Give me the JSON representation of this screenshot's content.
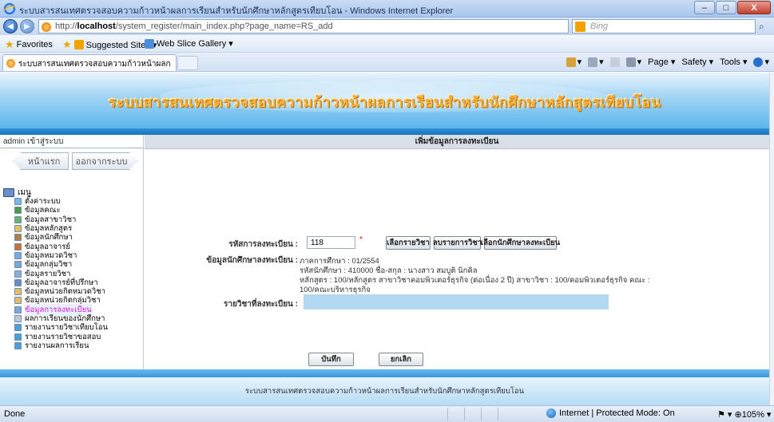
{
  "window": {
    "title": "ระบบสารสนเทศตรวจสอบความก้าวหน้าผลการเรียนสำหรับนักศึกษาหลักสูตรเทียบโอน - Windows Internet Explorer",
    "min": "–",
    "max": "□",
    "close": "X"
  },
  "address": {
    "url_prefix": "http://",
    "url_host": "localhost",
    "url_path": "/system_register/main_index.php?page_name=RS_add",
    "search_placeholder": "Bing"
  },
  "favorites": {
    "favorites_label": "Favorites",
    "suggested_label": "Suggested Sites ▾",
    "webslice_label": "Web Slice Gallery ▾"
  },
  "tab": {
    "label": "ระบบสารสนเทศตรวจสอบความก้าวหน้าผลการเรียนสำห..."
  },
  "command_bar": {
    "page": "Page ▾",
    "safety": "Safety ▾",
    "tools": "Tools ▾",
    "help": "▾"
  },
  "banner": {
    "title": "ระบบสารสนเทศตรวจสอบความก้าวหน้าผลการเรียนสำหรับนักศึกษาหลักสูตรเทียบโอน"
  },
  "sidebar": {
    "admin_line": "admin เข้าสู่ระบบ",
    "home_button": "หน้าแรก",
    "logout_button": "ออกจากระบบ",
    "menu_root": "เมนู",
    "items": [
      {
        "label": "ตั้งค่าระบบ",
        "color": "#7ab8e0"
      },
      {
        "label": "ข้อมูลคณะ",
        "color": "#4a9a4a"
      },
      {
        "label": "ข้อมูลสาขาวิชา",
        "color": "#6bb36b"
      },
      {
        "label": "ข้อมูลหลักสูตร",
        "color": "#e0c060"
      },
      {
        "label": "ข้อมูลนักศึกษา",
        "color": "#b08040"
      },
      {
        "label": "ข้อมูลอาจารย์",
        "color": "#d07030"
      },
      {
        "label": "ข้อมูลหมวดวิชา",
        "color": "#7aa8d8"
      },
      {
        "label": "ข้อมูลกลุ่มวิชา",
        "color": "#7aa8d8"
      },
      {
        "label": "ข้อมูลรายวิชา",
        "color": "#8ab0d8"
      },
      {
        "label": "ข้อมูลอาจารย์ที่ปรึกษา",
        "color": "#6a8ac0"
      },
      {
        "label": "ข้อมูลหน่วยกิตหมวดวิชา",
        "color": "#e0c060"
      },
      {
        "label": "ข้อมูลหน่วยกิตกลุ่มวิชา",
        "color": "#e0c060"
      },
      {
        "label": "ข้อมูลการลงทะเบียน",
        "color": "#7aa8d8"
      },
      {
        "label": "ผลการเรียนของนักศึกษา",
        "color": "#c0c8d8"
      },
      {
        "label": "รายงานรายวิชาเทียบโอน",
        "color": "#4aa0d8"
      },
      {
        "label": "รายงานรายวิชาขอสอบ",
        "color": "#4aa0d8"
      },
      {
        "label": "รายงานผลการเรียน",
        "color": "#4aa0d8"
      }
    ],
    "active_index": 12
  },
  "form": {
    "header": "เพิ่มข้อมูลการลงทะเบียน",
    "code_label": "รหัสการลงทะเบียน :",
    "code_value": "118",
    "required_mark": "*",
    "btn_select_subject": "เลือกรายวิชา",
    "btn_delete_subject": "ลบรายการวิชา",
    "btn_select_student": "เลือกนักศึกษาลงทะเบียน",
    "student_info_label": "ข้อมูลนักศึกษาลงทะเบียน :",
    "info_semester": "ภาคการศึกษา : 01/2554",
    "info_student": "รหัสนักศึกษา : 410000 ชื่อ-สกุล : นางสาว สมบูติ นิกคิล",
    "info_course": "หลักสูตร : 100/หลักสูตร สาขาวิชาคอมพิวเตอร์ธุรกิจ (ต่อเนื่อง 2 ปี) สาขาวิชา : 100/คอมพิวเตอร์ธุรกิจ คณะ :",
    "info_faculty": "100/คณะบริหารธุรกิจ",
    "subjects_label": "รายวิชาที่ลงทะเบียน :",
    "save_button": "บันทึก",
    "cancel_button": "ยกเลิก"
  },
  "footer": {
    "text": "ระบบสารสนเทศตรวจสอบความก้าวหน้าผลการเรียนสำหรับนักศึกษาหลักสูตรเทียบโอน"
  },
  "status": {
    "left": "Done",
    "zone": "Internet | Protected Mode: On",
    "zoom": "⚑ ▾  ⊕105% ▾"
  }
}
